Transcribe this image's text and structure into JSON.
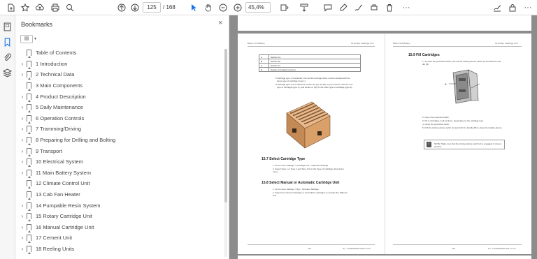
{
  "toolbar": {
    "page_current": "125",
    "page_total": "/ 168",
    "zoom": "45,4%",
    "icons": [
      "new-document-icon",
      "star-icon",
      "cloud-upload-icon",
      "print-icon",
      "zoom-search-icon",
      "previous-page-icon",
      "next-page-icon",
      "select-cursor-icon",
      "hand-tool-icon",
      "zoom-out-icon",
      "zoom-in-icon",
      "fit-page-icon",
      "scroll-mode-icon",
      "comment-icon",
      "highlight-icon",
      "draw-icon",
      "stamp-icon",
      "delete-icon",
      "more-tools-icon",
      "sign-icon",
      "lock-icon",
      "more-icon"
    ]
  },
  "sidebar": {
    "title": "Bookmarks",
    "close": "×",
    "options": "▤",
    "items": [
      {
        "label": "Table of Contents",
        "expandable": false
      },
      {
        "label": "1 Introduction",
        "expandable": true
      },
      {
        "label": "2 Technical Data",
        "expandable": true
      },
      {
        "label": "3 Main Components",
        "expandable": false
      },
      {
        "label": "4 Product Description",
        "expandable": true
      },
      {
        "label": "5 Daily Maintenance",
        "expandable": true
      },
      {
        "label": "6 Operation Controls",
        "expandable": true
      },
      {
        "label": "7 Tramming/Driving",
        "expandable": true
      },
      {
        "label": "8 Preparing for Drilling and Bolting",
        "expandable": true
      },
      {
        "label": "9 Transport",
        "expandable": true
      },
      {
        "label": "10 Electrical System",
        "expandable": true
      },
      {
        "label": "11 Main Battery System",
        "expandable": true
      },
      {
        "label": "12 Climate Control Unit",
        "expandable": false
      },
      {
        "label": "13 Cab Fan Heater",
        "expandable": false
      },
      {
        "label": "14 Pumpable Resin System",
        "expandable": true
      },
      {
        "label": "15 Rotary Cartridge Unit",
        "expandable": true
      },
      {
        "label": "16 Manual Cartridge Unit",
        "expandable": true
      },
      {
        "label": "17 Cement Unit",
        "expandable": true
      },
      {
        "label": "18 Reeling Units",
        "expandable": true
      }
    ]
  },
  "document": {
    "left_page": {
      "header_left": "Boltec S15 Battery",
      "header_right": "15 Rotary Cartridge Unit",
      "table": [
        {
          "c1": "A",
          "c2": "Section 1a"
        },
        {
          "c1": "B",
          "c2": "Section 1b"
        },
        {
          "c1": "C",
          "c2": "Section 1c"
        },
        {
          "c1": "D",
          "c2": "Section 2 (marked section)"
        }
      ],
      "bullets": [
        "If cartridge type 1 is selected, then all 30 cartridge tubes must be loaded with the",
        "same type of cartridge (type 1).",
        "If cartridge type 1+2 is selected, section 1a (A), 1b (B), 1c (C) must be used for one",
        "type of cartridge (type 1), and section 2 (D) for the other type of cartridge (type 2)."
      ],
      "section1_title": "15.7   Select Cartridge Type",
      "section1_steps": [
        "1.  Go to menu Settings > Cartridge unit > Operator Settings.",
        "2.  Select Type 1 or Type 1 and Type 2 from the Type of cartridges drop down",
        "     menu."
      ],
      "section2_title": "15.8   Select Manual or Automatic Cartridge Unit",
      "section2_steps": [
        "1.  Go to menu Settings > Rig > Operator Settings.",
        "2.  Select low manual cartridges or low bolt/ber cartridges to activate the different",
        "     unit."
      ],
      "footer_page": "124",
      "footer_doc": "No. TY000000000.000 en-US"
    },
    "right_page": {
      "header_left": "Boltec S15 Battery",
      "header_right": "15 Rotary Cartridge Unit",
      "section_title": "15.9   Fill Cartridges",
      "intro": [
        "1.  To open the protective hatch, pull out the locking device catch (A) and with the han",
        "     dle (B)."
      ],
      "steps": [
        "2.  Open the protective hatch.",
        "3.  Fill in cartridges in all sections, depending on the cartridge type.",
        "4.  Close the protective hatch.",
        "5.  Pull the locking device catch (A) and with the handle (B) to close the locking device."
      ],
      "note": "NOTE: Make sure that the locking device catch (A) is engaged in closed position.",
      "footer_page": "125",
      "footer_doc": "No. TY000000000.000 en-US"
    }
  }
}
